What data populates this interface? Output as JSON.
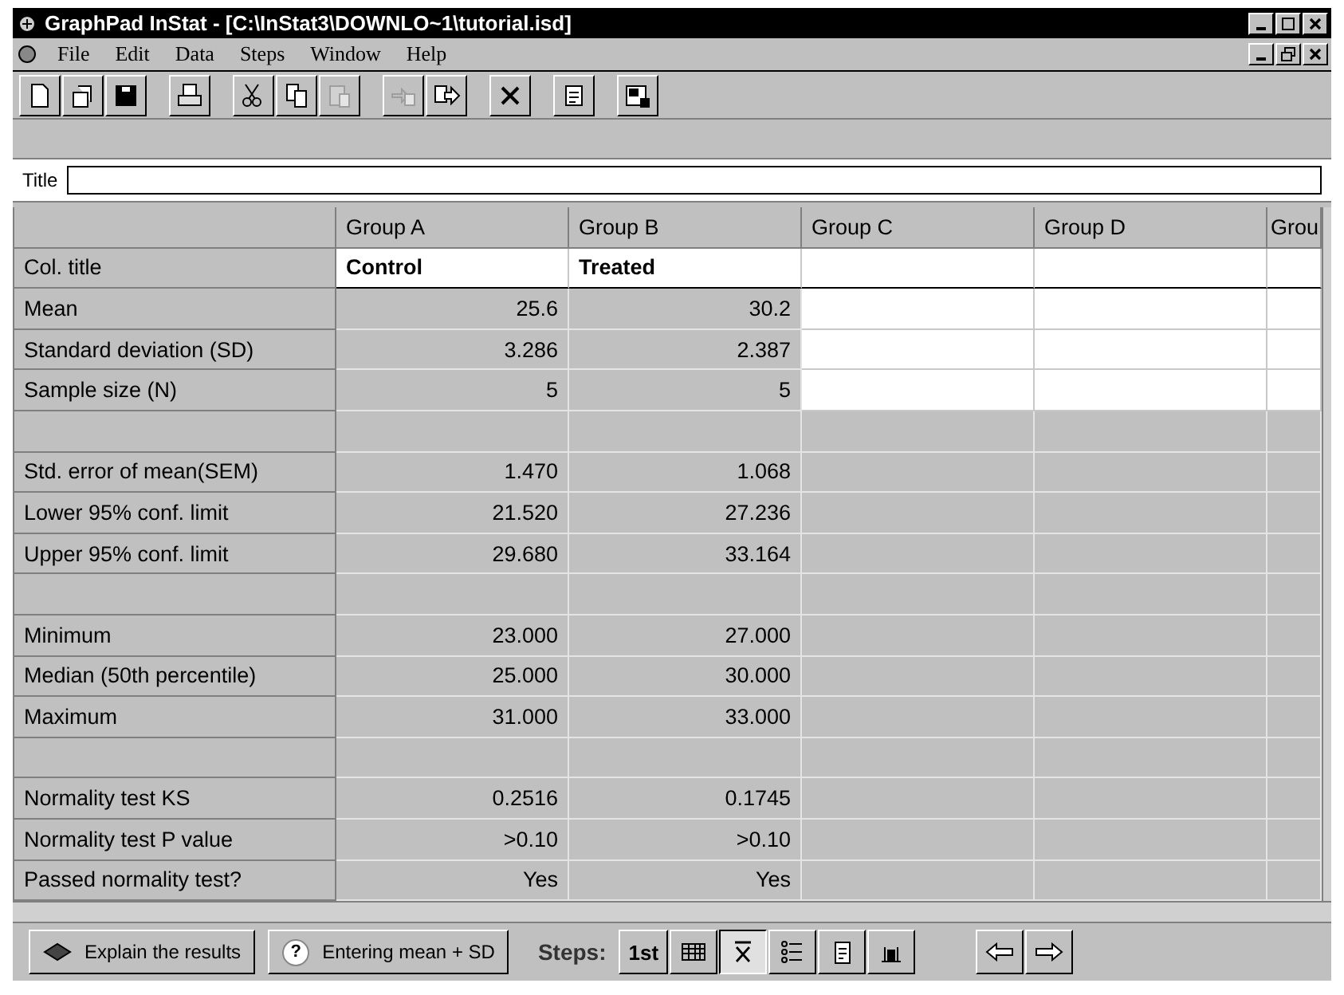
{
  "window": {
    "title": "GraphPad InStat - [C:\\InStat3\\DOWNLO~1\\tutorial.isd]"
  },
  "menu": [
    "File",
    "Edit",
    "Data",
    "Steps",
    "Window",
    "Help"
  ],
  "toolbar": [
    {
      "kind": "new",
      "disabled": false
    },
    {
      "kind": "open",
      "disabled": false
    },
    {
      "kind": "save",
      "disabled": false
    },
    {
      "kind": "sep"
    },
    {
      "kind": "print",
      "disabled": false
    },
    {
      "kind": "sep"
    },
    {
      "kind": "cut",
      "disabled": false
    },
    {
      "kind": "copy",
      "disabled": false
    },
    {
      "kind": "paste",
      "disabled": true
    },
    {
      "kind": "sep"
    },
    {
      "kind": "import",
      "disabled": true
    },
    {
      "kind": "export",
      "disabled": false
    },
    {
      "kind": "sep"
    },
    {
      "kind": "delete",
      "disabled": false
    },
    {
      "kind": "sep"
    },
    {
      "kind": "notes",
      "disabled": false
    },
    {
      "kind": "sep"
    },
    {
      "kind": "layout",
      "disabled": false
    }
  ],
  "title_field": {
    "label": "Title"
  },
  "table": {
    "columns": [
      "Group A",
      "Group B",
      "Group C",
      "Group D",
      "Grou"
    ],
    "rows": [
      {
        "kind": "title",
        "label": "Col. title",
        "cells": [
          "Control",
          "Treated"
        ]
      },
      {
        "kind": "input",
        "label": "Mean",
        "cells": [
          "25.6",
          "30.2"
        ]
      },
      {
        "kind": "input",
        "label": "Standard deviation (SD)",
        "cells": [
          "3.286",
          "2.387"
        ]
      },
      {
        "kind": "input",
        "label": "Sample size (N)",
        "cells": [
          "5",
          "5"
        ]
      },
      {
        "kind": "spacer"
      },
      {
        "kind": "result",
        "label": "Std. error of mean(SEM)",
        "cells": [
          "1.470",
          "1.068"
        ]
      },
      {
        "kind": "result",
        "label": "Lower 95% conf. limit",
        "cells": [
          "21.520",
          "27.236"
        ]
      },
      {
        "kind": "result",
        "label": "Upper 95% conf. limit",
        "cells": [
          "29.680",
          "33.164"
        ]
      },
      {
        "kind": "spacer"
      },
      {
        "kind": "result",
        "label": "Minimum",
        "cells": [
          "23.000",
          "27.000"
        ]
      },
      {
        "kind": "result",
        "label": "Median (50th percentile)",
        "cells": [
          "25.000",
          "30.000"
        ]
      },
      {
        "kind": "result",
        "label": "Maximum",
        "cells": [
          "31.000",
          "33.000"
        ]
      },
      {
        "kind": "spacer"
      },
      {
        "kind": "result",
        "label": "Normality test KS",
        "cells": [
          "0.2516",
          "0.1745"
        ]
      },
      {
        "kind": "result",
        "label": "Normality test P value",
        "cells": [
          ">0.10",
          ">0.10"
        ]
      },
      {
        "kind": "result",
        "label": "Passed normality test?",
        "cells": [
          "Yes",
          "Yes"
        ]
      }
    ]
  },
  "bottom_bar": {
    "explain_button": "Explain the results",
    "help_button": "Entering mean + SD",
    "help_icon": "?",
    "steps_label": "Steps:",
    "steps": [
      {
        "kind": "text",
        "label": "1st",
        "selected": false
      },
      {
        "kind": "grid",
        "selected": false
      },
      {
        "kind": "xbar",
        "selected": true
      },
      {
        "kind": "list",
        "selected": false
      },
      {
        "kind": "pvalue",
        "selected": false
      },
      {
        "kind": "graph",
        "selected": false
      }
    ]
  }
}
